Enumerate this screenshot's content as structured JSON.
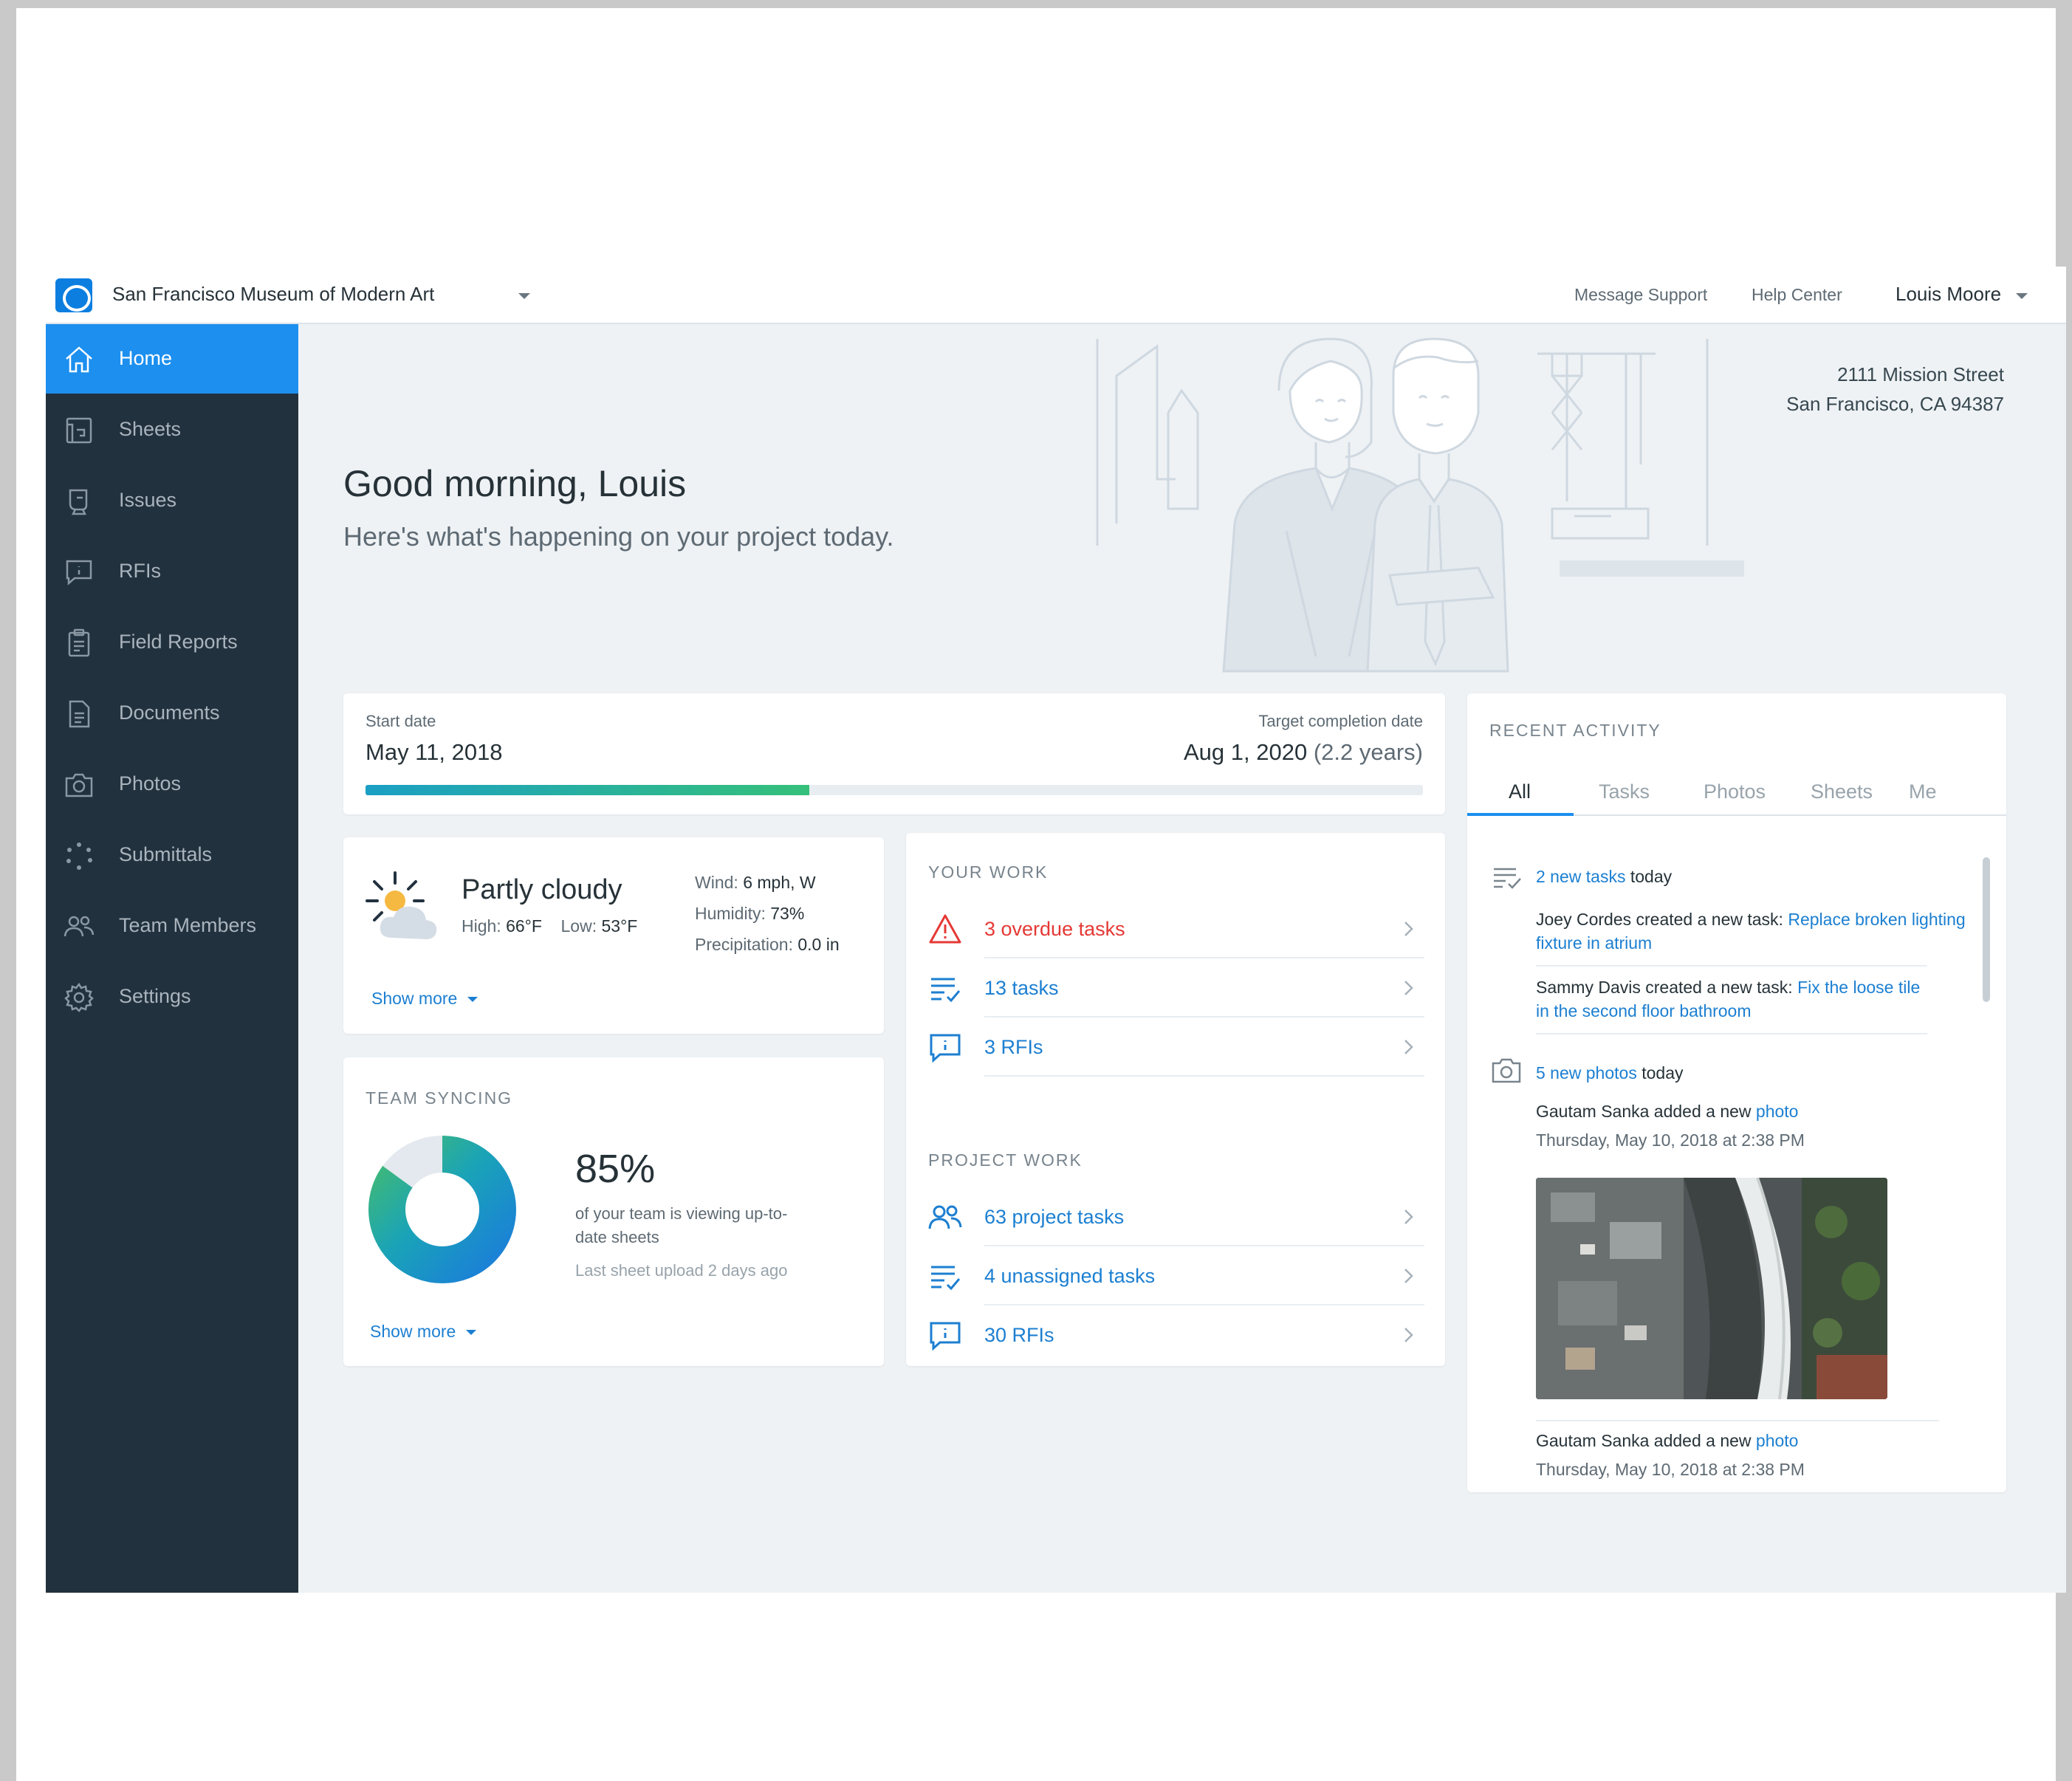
{
  "header": {
    "project_name": "San Francisco Museum of Modern Art",
    "links": [
      "Message Support",
      "Help Center"
    ],
    "user_name": "Louis Moore"
  },
  "sidebar": {
    "items": [
      {
        "label": "Home",
        "icon": "home-icon",
        "active": true
      },
      {
        "label": "Sheets",
        "icon": "sheets-icon"
      },
      {
        "label": "Issues",
        "icon": "issues-icon"
      },
      {
        "label": "RFIs",
        "icon": "rfi-icon"
      },
      {
        "label": "Field Reports",
        "icon": "clipboard-icon"
      },
      {
        "label": "Documents",
        "icon": "document-icon"
      },
      {
        "label": "Photos",
        "icon": "camera-icon"
      },
      {
        "label": "Submittals",
        "icon": "submittals-icon"
      },
      {
        "label": "Team Members",
        "icon": "team-icon"
      },
      {
        "label": "Settings",
        "icon": "gear-icon"
      }
    ]
  },
  "hero": {
    "greeting": "Good morning, Louis",
    "subtitle": "Here's what's happening on your project today.",
    "address_line1": "2111 Mission Street",
    "address_line2": "San Francisco, CA 94387"
  },
  "dates": {
    "start_label": "Start date",
    "start_value": "May 11, 2018",
    "target_label": "Target completion date",
    "target_value": "Aug 1, 2020",
    "target_duration": "(2.2 years)",
    "progress_fraction": 0.42
  },
  "weather": {
    "condition": "Partly cloudy",
    "high_label": "High:",
    "high_value": "66°F",
    "low_label": "Low:",
    "low_value": "53°F",
    "wind_label": "Wind:",
    "wind_value": "6 mph, W",
    "humidity_label": "Humidity:",
    "humidity_value": "73%",
    "precip_label": "Precipitation:",
    "precip_value": "0.0 in",
    "show_more": "Show more"
  },
  "team_syncing": {
    "title": "TEAM SYNCING",
    "percent_text": "85%",
    "percent_value": 85,
    "description": "of your team is viewing up-to-date sheets",
    "last_upload": "Last sheet upload 2 days ago",
    "show_more": "Show more",
    "colors": {
      "start": "#1b7fd8",
      "mid": "#1aa3b8",
      "end": "#3fb878",
      "rest": "#e3e9ee"
    }
  },
  "your_work": {
    "title": "YOUR WORK",
    "items": [
      {
        "label": "3 overdue tasks",
        "icon": "warning-icon",
        "style": "red"
      },
      {
        "label": "13 tasks",
        "icon": "tasks-icon"
      },
      {
        "label": "3 RFIs",
        "icon": "rfi-icon"
      }
    ]
  },
  "project_work": {
    "title": "PROJECT WORK",
    "items": [
      {
        "label": "63 project tasks",
        "icon": "team-icon"
      },
      {
        "label": "4 unassigned tasks",
        "icon": "tasks-icon"
      },
      {
        "label": "30 RFIs",
        "icon": "rfi-icon"
      }
    ]
  },
  "activity": {
    "title": "RECENT ACTIVITY",
    "tabs": [
      "All",
      "Tasks",
      "Photos",
      "Sheets",
      "Me"
    ],
    "tasks_group": {
      "count_link": "2 new tasks",
      "suffix": "today",
      "entries": [
        {
          "prefix": "Joey Cordes created a new task: ",
          "link_line1": "Replace broken lighting",
          "link_line2": "fixture in atrium"
        },
        {
          "prefix": "Sammy Davis created a new task: ",
          "link_line1": "Fix the loose tile",
          "link_line2": "in the second floor bathroom"
        }
      ]
    },
    "photos_group": {
      "count_link": "5 new photos",
      "suffix": "today",
      "entries": [
        {
          "prefix": "Gautam Sanka added a new ",
          "link": "photo",
          "date": "Thursday, May 10, 2018 at 2:38 PM"
        },
        {
          "prefix": "Gautam Sanka added a new ",
          "link": "photo",
          "date": "Thursday, May 10, 2018 at 2:38 PM"
        }
      ]
    }
  }
}
